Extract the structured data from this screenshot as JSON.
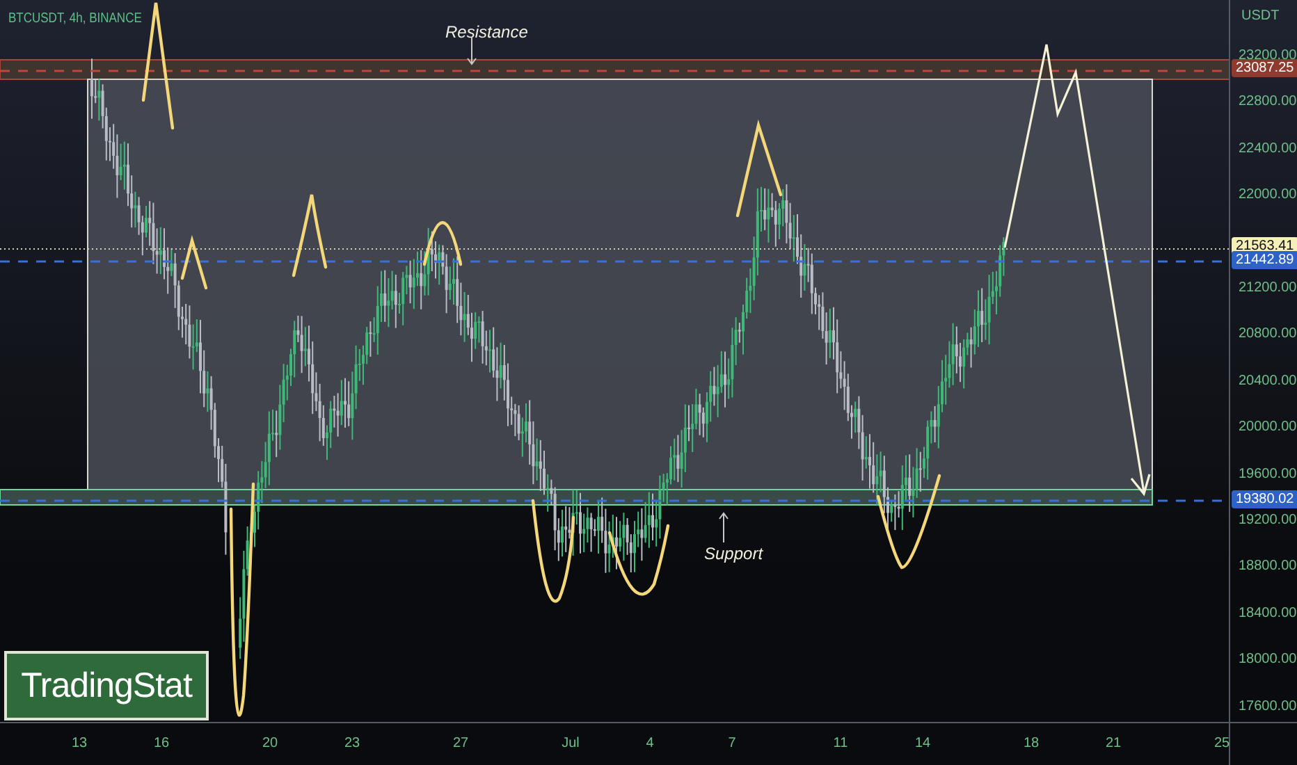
{
  "symbol": "BTCUSDT, 4h, BINANCE",
  "annotations": [
    {
      "kind": "resistance",
      "text": "Resistance"
    },
    {
      "kind": "support",
      "text": "Support"
    }
  ],
  "logo": "TradingStat",
  "price_axis": {
    "unit": "USDT",
    "ticks": [
      "23200.00",
      "22800.00",
      "22400.00",
      "22000.00",
      "21200.00",
      "20800.00",
      "20400.00",
      "20000.00",
      "19600.00",
      "19200.00",
      "18800.00",
      "18400.00",
      "18000.00",
      "17600.00"
    ]
  },
  "price_labels": [
    {
      "text": "23087.25",
      "color": "#8e3a2e"
    },
    {
      "text": "21563.41",
      "color": "#f5f0b8"
    },
    {
      "text": "21442.89",
      "color": "#2e62c4"
    },
    {
      "text": "19380.02",
      "color": "#2e62c4"
    }
  ],
  "time_axis": [
    "13",
    "16",
    "20",
    "23",
    "27",
    "Jul",
    "4",
    "7",
    "11",
    "14",
    "18",
    "21",
    "25"
  ]
}
